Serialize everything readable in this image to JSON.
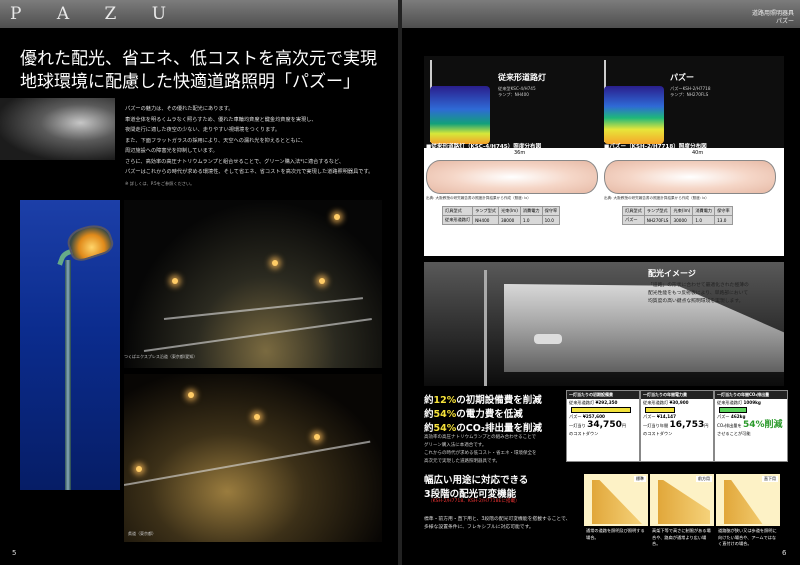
{
  "left": {
    "brand": "P A Z U",
    "headline_lines": [
      "優れた配光、省エネ、低コストを高次元で実現",
      "地球環境に配慮した快適道路照明「パズー」"
    ],
    "intro_lines": [
      "パズーの魅力は、その優れた配光にあります。",
      "車道全体を明るくムラなく照らすため、優れた車輪均斉度と鍵金均斉度を実現し、",
      "夜間走行に適した夜空の少ない、走りやすい視環境をつくります。",
      "また、下面フラットガラスの採用により、天空への漏れ光を抑えるとともに、",
      "周辺施設への障害光を抑制しています。",
      "さらに、高効率の高圧ナトリウムランプと組合せることで、グリーン購入法*に適合するなど、",
      "パズーはこれからの時代が求める環境性、そして省エネ、省コストを高次元で実現した道路照明器具です。"
    ],
    "intro_note": "※ 詳しくは、P.5をご参照ください。",
    "photo1_caption": "つくばエクスプレス沿道（東京都/愛知）",
    "photo3_caption": "県道（東京都）",
    "page_number": "5"
  },
  "right": {
    "category_line1": "道路用照明器具",
    "category_line2": "パズー",
    "diagram1": {
      "title": "従来形道路灯",
      "sub1": "従来型KSC-4/H745",
      "sub2": "ランプ：NH400",
      "tag": "■従来形道路灯（KSC-4/H745）照度分布図",
      "width_label": "36m",
      "note": "出典: 大阪教授の研究報告書の照度計算結果から作成（照度: lx）"
    },
    "diagram2": {
      "title": "パズー",
      "sub1": "パズーKSH-2/H7718",
      "sub2": "ランプ：NH270FLS",
      "tag": "■パズー（KSH-2/H7718）照度分布図",
      "width_label": "40m",
      "note": "出典: 大阪教授の研究報告書の照度計算結果から作成（照度: lx）"
    },
    "table1": [
      [
        "灯具型式",
        "ランプ型式",
        "光束(lm)",
        "消費電力",
        "保守率"
      ],
      [
        "従来形道路灯",
        "NH400",
        "38000",
        "1.0",
        "10.0"
      ]
    ],
    "table2": [
      [
        "灯具型式",
        "ランプ型式",
        "光束(lm)",
        "消費電力",
        "保守率"
      ],
      [
        "パズー",
        "NH270FLS",
        "30000",
        "1.0",
        "13.0"
      ]
    ],
    "light_image": {
      "title": "配光イメージ",
      "text_lines": [
        "「道路」の形状に合わせて最適化された極薄の",
        "配光性能をもつ反射板により、単路部において",
        "均質度の高い鍵点な照明環境を実現します。"
      ]
    },
    "benefits": [
      {
        "pre": "約",
        "pct": "12%",
        "post": "の初期設備費を削減"
      },
      {
        "pre": "約",
        "pct": "54%",
        "post": "の電力費を低減"
      },
      {
        "pre": "約",
        "pct": "54%",
        "post": "のCO₂排出量を削減"
      }
    ],
    "benefit_text": [
      "高効率の高圧ナトリウムランプとの組み合わせることで",
      "グリーン購入法に本適合です。",
      "これからの時代が求める低コスト・省エネ・環境保全を",
      "高次元で実現した道路照明器具です。"
    ],
    "cost_boxes": [
      {
        "title": "一灯当たりの初期設備費",
        "row1_label": "従来形道路灯",
        "row1_value": "¥292,350",
        "row2_label": "パズー",
        "row2_value": "¥257,600",
        "big_prefix": "一灯当り",
        "big_value": "34,750",
        "big_unit": "円",
        "big_suffix": "のコストダウン"
      },
      {
        "title": "一灯当たりの年間電力費",
        "row1_label": "従来形道路灯",
        "row1_value": "¥30,900",
        "row2_label": "パズー",
        "row2_value": "¥14,147",
        "big_prefix": "一灯当り年間",
        "big_value": "16,753",
        "big_unit": "円",
        "big_suffix": "のコストダウン"
      },
      {
        "title": "一灯当たりの年間CO₂排出量",
        "row1_label": "従来形道路灯",
        "row1_value": "1009kg",
        "row2_label": "パズー",
        "row2_value": "462kg",
        "big_prefix": "CO₂排出量を",
        "big_value": "54%削減",
        "big_unit": "",
        "big_suffix": "させることが可能"
      }
    ],
    "feature": {
      "title_line1": "幅広い用途に対応できる",
      "title_line2": "3段階の配光可変機能",
      "sub": "（KSH-2/H7718、KSH-2/H7718Eに搭載）",
      "text_lines": [
        "標準・前方用・直下用と、3段階の配光可変機能を搭載することで、",
        "多様な設置条件に、フレキシブルに対応可能です。"
      ]
    },
    "modes": [
      {
        "name": "標準",
        "caption": "通常の道路を照明及び照明する場合。"
      },
      {
        "name": "前方用",
        "caption": "高架下等で高さに制限がある場合や、路肩が通常より広い場合。"
      },
      {
        "name": "直下用",
        "caption": "道路脇が狭い又は歩道を照明に向けたい場合や、アームではなく直付けの場合。"
      }
    ],
    "page_number": "6"
  }
}
